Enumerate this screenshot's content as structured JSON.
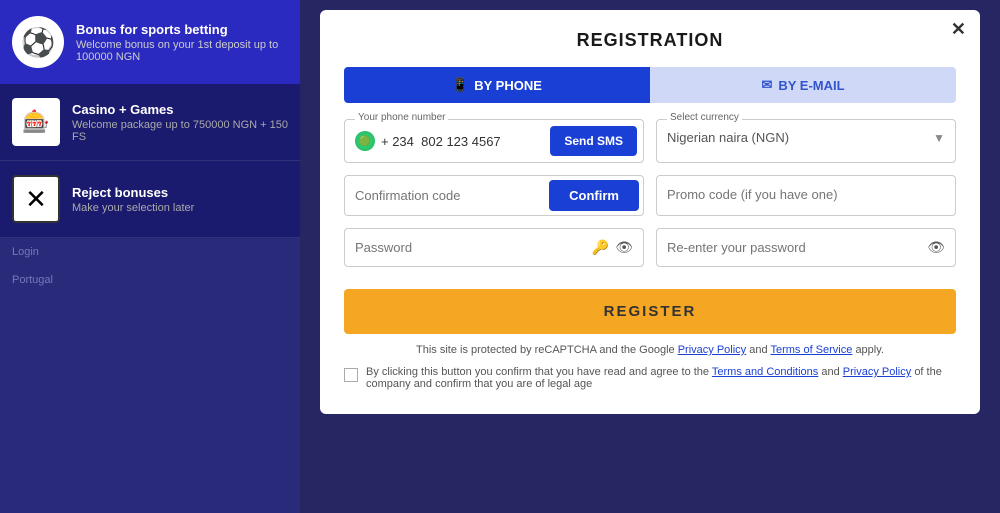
{
  "sidebar": {
    "bonus": {
      "icon": "⚽",
      "title": "Bonus for sports betting",
      "description": "Welcome bonus on your 1st deposit up to 100000 NGN"
    },
    "item1": {
      "icon": "🎰",
      "title": "Casino + Games",
      "description": "Welcome package up to 750000 NGN + 150 FS"
    },
    "item2": {
      "icon": "✖",
      "title": "Reject bonuses",
      "description": "Make your selection later"
    },
    "bottom_label1": "Login",
    "bottom_label2": "Portugal"
  },
  "modal": {
    "close_label": "✕",
    "title": "REGISTRATION",
    "tab_phone": "BY PHONE",
    "tab_email": "BY E-MAIL",
    "phone_label": "Your phone number",
    "phone_prefix": "+ 234",
    "phone_number": "802 123 4567",
    "send_sms_label": "Send SMS",
    "currency_label": "Select currency",
    "currency_value": "Nigerian naira (NGN)",
    "confirmation_placeholder": "Confirmation code",
    "confirm_button": "Confirm",
    "promo_placeholder": "Promo code (if you have one)",
    "password_placeholder": "Password",
    "reenter_placeholder": "Re-enter your password",
    "register_button": "REGISTER",
    "recaptcha_text": "This site is protected by reCAPTCHA and the Google",
    "privacy_policy_label": "Privacy Policy",
    "and_label": "and",
    "tos_label": "Terms of Service",
    "apply_text": "apply.",
    "checkbox_text": "By clicking this button you confirm that you have read and agree to the",
    "tos_label2": "Terms and Conditions",
    "and_label2": "and",
    "privacy_label2": "Privacy Policy",
    "checkbox_suffix": "of the company and confirm that you are of legal age"
  }
}
